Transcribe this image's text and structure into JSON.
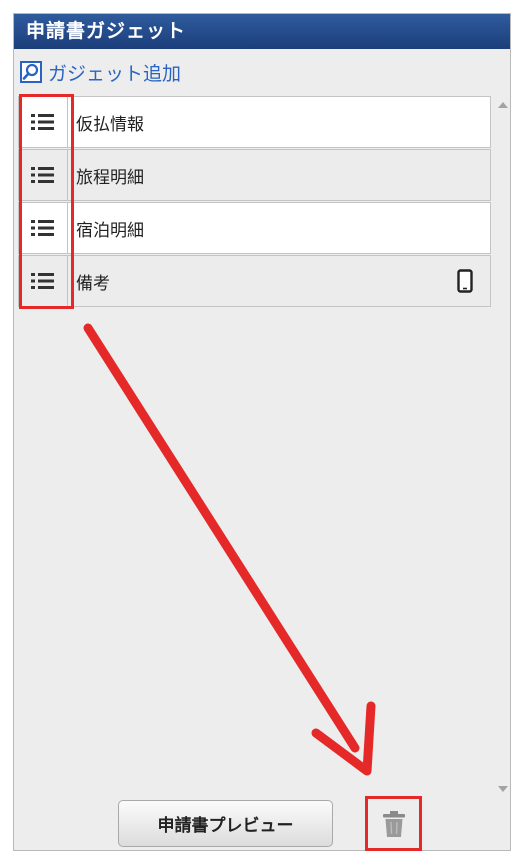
{
  "panel": {
    "title": "申請書ガジェット",
    "add_gadget_label": "ガジェット追加"
  },
  "gadgets": [
    {
      "label": "仮払情報",
      "icon": "drag-handle-icon"
    },
    {
      "label": "旅程明細",
      "icon": "drag-handle-icon"
    },
    {
      "label": "宿泊明細",
      "icon": "drag-handle-icon"
    },
    {
      "label": "備考",
      "icon": "drag-handle-icon",
      "extra_icon": "mobile-device-icon"
    }
  ],
  "footer": {
    "preview_label": "申請書プレビュー",
    "trash_icon": "trash-icon"
  },
  "colors": {
    "header": "#1c3e7a",
    "link": "#2a64c2",
    "annotation": "#e52828"
  }
}
